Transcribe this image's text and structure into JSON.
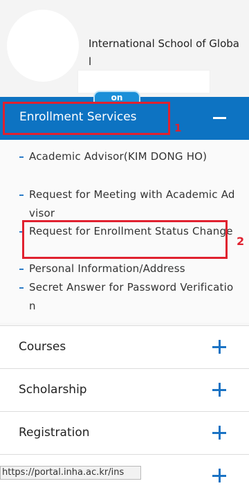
{
  "profile": {
    "school_name": "International School of Global",
    "badge": "on"
  },
  "enrollment": {
    "title": "Enrollment Services",
    "items": [
      "Academic Advisor(KIM DONG HO)",
      "Request for Meeting with Academic Advisor",
      "Request for Enrollment Status Change",
      "Personal Information/Address",
      "Secret Answer for Password Verification"
    ]
  },
  "annotations": {
    "label_1": "1",
    "label_2": "2"
  },
  "accordion": [
    {
      "label": "Courses"
    },
    {
      "label": "Scholarship"
    },
    {
      "label": "Registration"
    },
    {
      "label": ""
    }
  ],
  "status_bar": {
    "url": "https://portal.inha.ac.kr/ins"
  },
  "colors": {
    "header_bg": "#0d73c2",
    "accent": "#1a73c4",
    "highlight": "#e0212f"
  }
}
